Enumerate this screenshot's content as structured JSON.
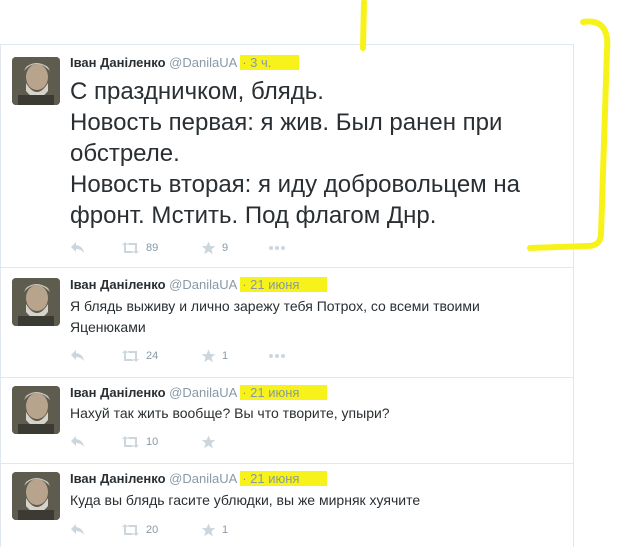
{
  "colors": {
    "highlight": "#f7f31a",
    "action_grey": "#ccd6dd",
    "meta_grey": "#8899a6",
    "text": "#292f33"
  },
  "icons": [
    "reply-icon",
    "retweet-icon",
    "favorite-icon",
    "more-icon"
  ],
  "tweets": [
    {
      "author": "Іван Даніленко",
      "handle": "@DanilaUA",
      "separator": "·",
      "time": "3 ч.",
      "lines": [
        "С праздничком, блядь.",
        "Новость первая: я жив. Был ранен при",
        "обстреле.",
        "Новость вторая: я иду добровольцем на",
        "фронт. Мстить. Под флагом Днр."
      ],
      "retweets": "89",
      "favorites": "9"
    },
    {
      "author": "Іван Даніленко",
      "handle": "@DanilaUA",
      "separator": "·",
      "time": "21 июня",
      "lines": [
        "Я блядь выживу и лично зарежу тебя Потрох, со всеми твоими",
        "Яценюками"
      ],
      "retweets": "24",
      "favorites": "1"
    },
    {
      "author": "Іван Даніленко",
      "handle": "@DanilaUA",
      "separator": "·",
      "time": "21 июня",
      "lines": [
        "Нахуй так жить вообще? Вы что творите, упыри?"
      ],
      "retweets": "10",
      "favorites": ""
    },
    {
      "author": "Іван Даніленко",
      "handle": "@DanilaUA",
      "separator": "·",
      "time": "21 июня",
      "lines": [
        "Куда вы блядь гасите ублюдки, вы же мирняк хуячите"
      ],
      "retweets": "20",
      "favorites": "1"
    }
  ]
}
